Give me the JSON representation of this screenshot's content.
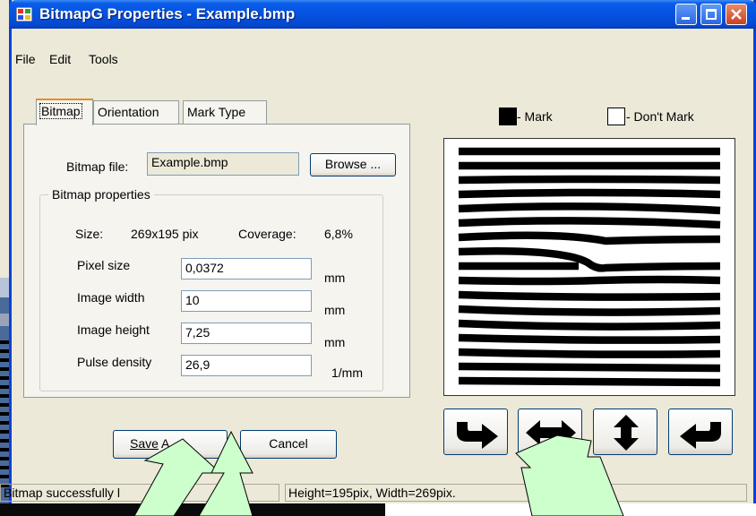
{
  "window": {
    "title": "BitmapG Properties - Example.bmp"
  },
  "menu": [
    {
      "label": "File",
      "key": "F"
    },
    {
      "label": "Edit",
      "key": "E"
    },
    {
      "label": "Tools",
      "key": "T"
    }
  ],
  "tabs": [
    "Bitmap",
    "Orientation",
    "Mark Type"
  ],
  "bitmap_file": {
    "label": "Bitmap file:",
    "value": "Example.bmp",
    "browse_label": "Browse ..."
  },
  "bitmap_properties": {
    "title": "Bitmap properties",
    "size_label": "Size:",
    "size_value": "269x195 pix",
    "coverage_label": "Coverage:",
    "coverage_value": "6,8%",
    "fields": [
      {
        "label": "Pixel size",
        "value": "0,0372",
        "unit": "mm"
      },
      {
        "label": "Image width",
        "value": "10",
        "unit": "mm"
      },
      {
        "label": "Image height",
        "value": "7,25",
        "unit": "mm"
      },
      {
        "label": "Pulse density",
        "value": "26,9",
        "unit": "1/mm"
      }
    ]
  },
  "legend": {
    "mark": "- Mark",
    "dont_mark": "- Don't Mark"
  },
  "buttons": {
    "save": "Save",
    "save_partial": "Save A",
    "cancel": "Cancel"
  },
  "status": {
    "left": "Bitmap successfully l",
    "right": "Height=195pix, Width=269pix."
  },
  "colors": {
    "titlebar": "#0453e0",
    "overlay_arrow_fill": "#CCFFCC",
    "accent_tab": "#E68B2C"
  },
  "icons": [
    "rotate-right-icon",
    "flip-horizontal-icon",
    "flip-vertical-icon",
    "rotate-left-icon"
  ]
}
